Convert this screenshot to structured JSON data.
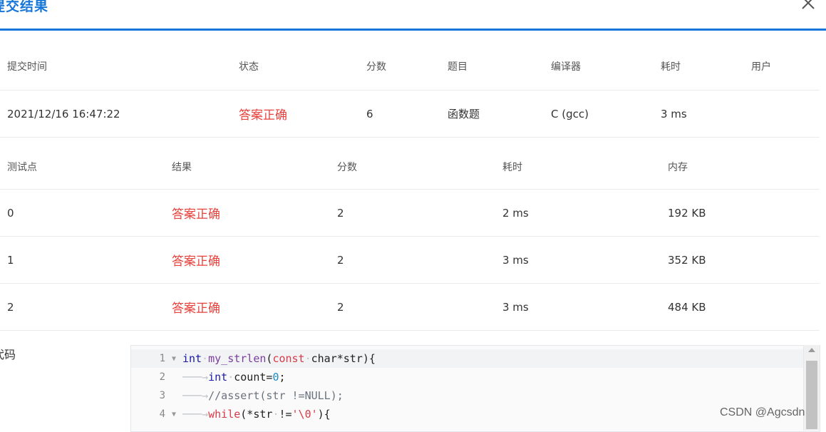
{
  "dialog": {
    "title": "提交结果",
    "close_label": "×"
  },
  "summary": {
    "headers": [
      "提交时间",
      "状态",
      "分数",
      "题目",
      "编译器",
      "耗时",
      "用户"
    ],
    "row": {
      "time": "2021/12/16 16:47:22",
      "status": "答案正确",
      "score": "6",
      "problem": "函数题",
      "compiler": "C (gcc)",
      "duration": "3 ms",
      "user": ""
    }
  },
  "cases": {
    "headers": [
      "测试点",
      "结果",
      "分数",
      "耗时",
      "内存"
    ],
    "rows": [
      {
        "id": "0",
        "result": "答案正确",
        "score": "2",
        "time": "2 ms",
        "memory": "192 KB"
      },
      {
        "id": "1",
        "result": "答案正确",
        "score": "2",
        "time": "3 ms",
        "memory": "352 KB"
      },
      {
        "id": "2",
        "result": "答案正确",
        "score": "2",
        "time": "3 ms",
        "memory": "484 KB"
      }
    ]
  },
  "code": {
    "label": "代码",
    "line_numbers": [
      "1",
      "2",
      "3",
      "4"
    ]
  },
  "watermark": "CSDN @Agcsdn",
  "colors": {
    "accent": "#1677d9",
    "accepted": "#e8413c"
  }
}
